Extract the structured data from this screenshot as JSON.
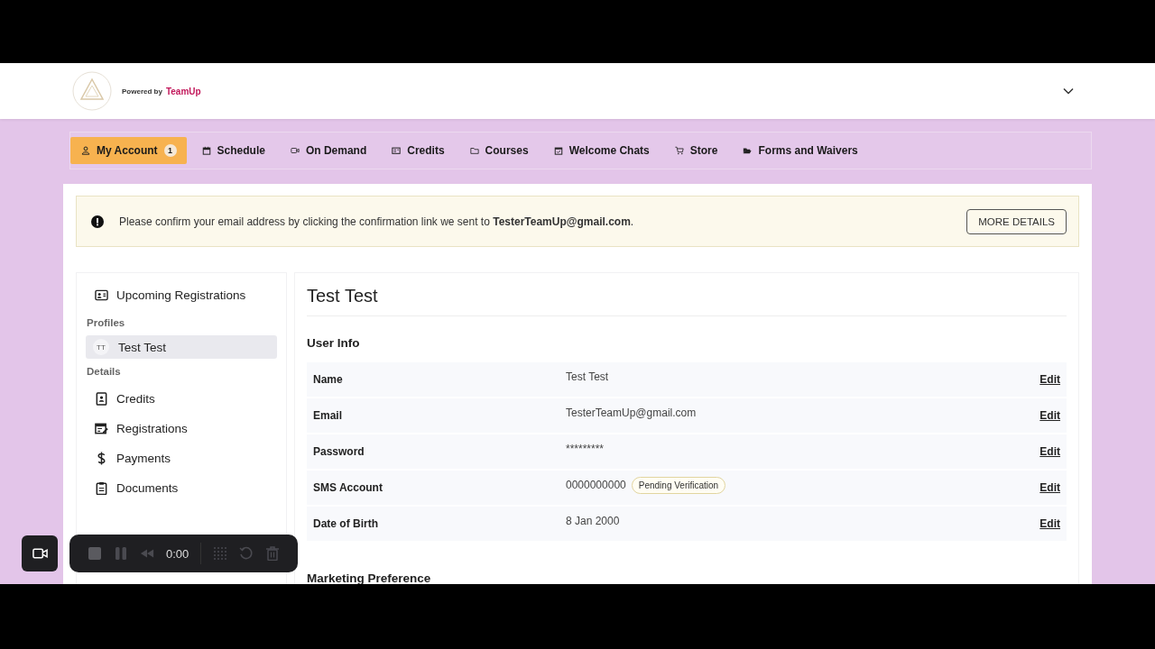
{
  "header": {
    "powered_by": "Powered by",
    "brand": "TeamUp"
  },
  "nav": [
    {
      "label": "My Account",
      "kind": "user",
      "badge": "1",
      "selected": true
    },
    {
      "label": "Schedule",
      "kind": "calendar",
      "selected": false
    },
    {
      "label": "On Demand",
      "kind": "video",
      "selected": false
    },
    {
      "label": "Credits",
      "kind": "card",
      "selected": false
    },
    {
      "label": "Courses",
      "kind": "folder",
      "selected": false
    },
    {
      "label": "Welcome Chats",
      "kind": "calendar-check",
      "selected": false
    },
    {
      "label": "Store",
      "kind": "cart",
      "selected": false
    },
    {
      "label": "Forms and Waivers",
      "kind": "folder-open",
      "selected": false
    }
  ],
  "alert": {
    "text": "Please confirm your email address by clicking the confirmation link we sent to **TesterTeamUp@gmail.com**.",
    "button": "MORE DETAILS"
  },
  "sidebar": {
    "top_item": "Upcoming Registrations",
    "sections": [
      {
        "heading": "Profiles",
        "items": [
          {
            "label": "Test Test",
            "initials": "TT",
            "kind": "profile",
            "selected": true
          }
        ]
      },
      {
        "heading": "Details",
        "items": [
          {
            "label": "Credits",
            "kind": "badge",
            "selected": false
          },
          {
            "label": "Registrations",
            "kind": "calendar-edit",
            "selected": false
          },
          {
            "label": "Payments",
            "kind": "dollar",
            "selected": false
          },
          {
            "label": "Documents",
            "kind": "clipboard",
            "selected": false
          }
        ]
      }
    ]
  },
  "profile": {
    "title": "Test Test",
    "section": "User Info",
    "rows": [
      {
        "label": "Name",
        "value": "Test Test",
        "action": "Edit"
      },
      {
        "label": "Email",
        "value": "TesterTeamUp@gmail.com",
        "action": "Edit"
      },
      {
        "label": "Password",
        "value": "*********",
        "action": "Edit"
      },
      {
        "label": "SMS Account",
        "value": "0000000000",
        "badge": "Pending Verification",
        "action": "Edit"
      },
      {
        "label": "Date of Birth",
        "value": "8 Jan 2000",
        "action": "Edit"
      }
    ],
    "next_section": "Marketing Preference"
  },
  "recorder": {
    "time": "0:00"
  }
}
